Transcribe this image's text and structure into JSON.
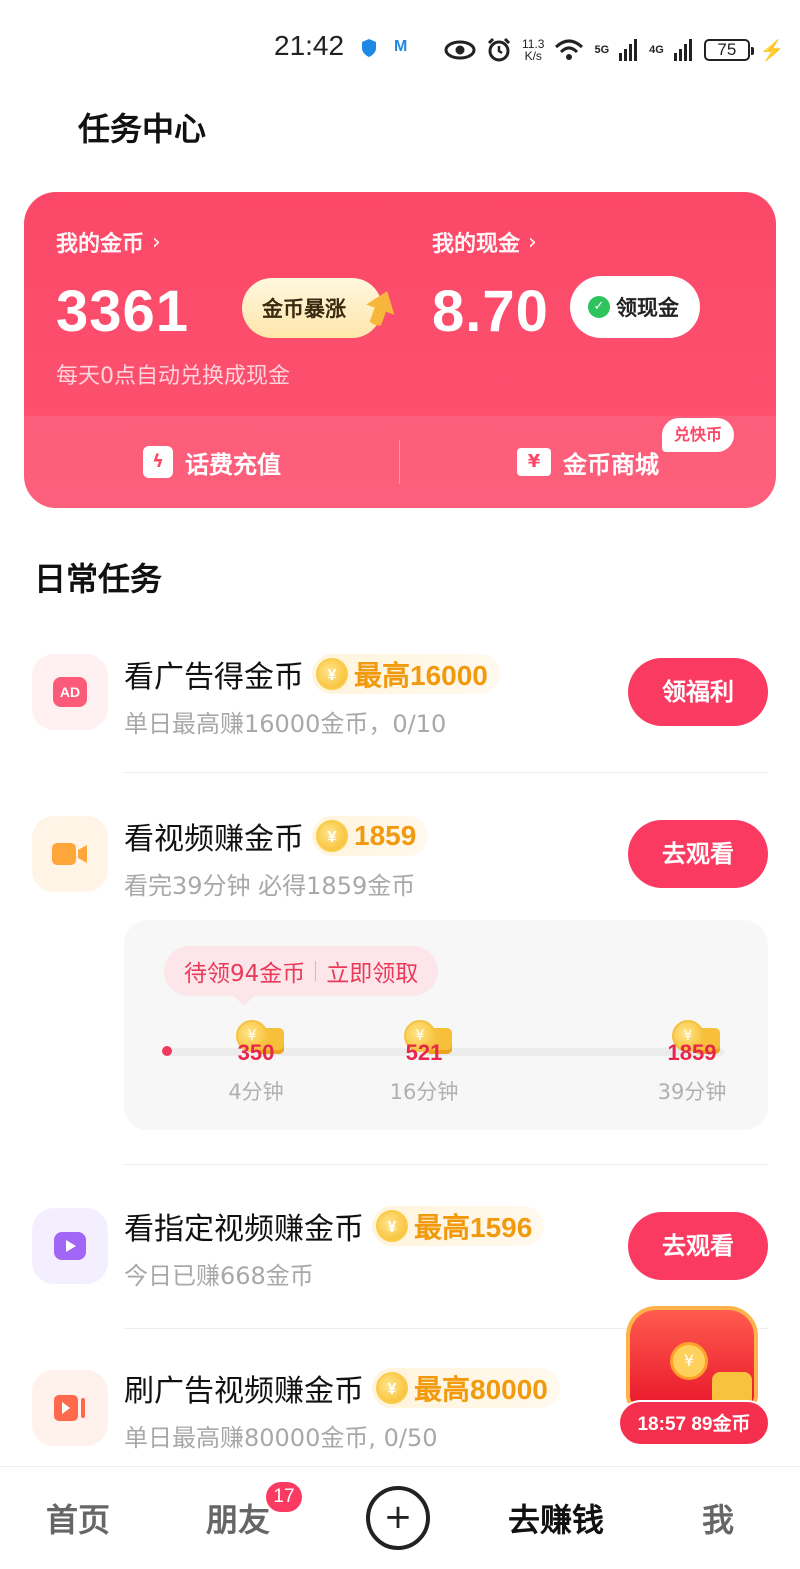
{
  "status_bar": {
    "time": "21:42",
    "speed_top": "11.3",
    "speed_bottom": "K/s",
    "net1": "5G",
    "net2": "4G",
    "battery": "75"
  },
  "header": {
    "title": "任务中心"
  },
  "wallet": {
    "coins_label": "我的金币",
    "coins_value": "3361",
    "coins_boost_label": "金币暴涨",
    "cash_label": "我的现金",
    "cash_value": "8.70",
    "cash_button_label": "领现金",
    "note": "每天0点自动兑换成现金",
    "recharge_label": "话费充值",
    "mall_label": "金币商城",
    "mall_badge": "兑快币"
  },
  "daily": {
    "title": "日常任务",
    "tasks": [
      {
        "title": "看广告得金币",
        "reward": "最高16000",
        "desc": "单日最高赚16000金币，0/10",
        "button": "领福利",
        "icon": "ad-icon",
        "icon_text": "AD",
        "icon_bg": "#fff0f2",
        "icon_fg": "#fb4868"
      },
      {
        "title": "看视频赚金币",
        "reward": "1859",
        "desc": "看完39分钟 必得1859金币",
        "button": "去观看",
        "icon": "video-camera-icon",
        "icon_bg": "#fff4e6",
        "icon_fg": "#ffa63a"
      },
      {
        "title": "看指定视频赚金币",
        "reward": "最高1596",
        "desc": "今日已赚668金币",
        "button": "去观看",
        "icon": "play-icon",
        "icon_bg": "#f4efff",
        "icon_fg": "#a166f5"
      },
      {
        "title": "刷广告视频赚金币",
        "reward": "最高80000",
        "desc": "单日最高赚80000金币, 0/50",
        "icon": "ad-video-icon",
        "icon_bg": "#fff1ec",
        "icon_fg": "#ff6a4d"
      }
    ]
  },
  "video_progress": {
    "pending_text": "待领94金币",
    "claim_text": "立即领取",
    "milestones": [
      {
        "value": "350",
        "time": "4分钟"
      },
      {
        "value": "521",
        "time": "16分钟"
      },
      {
        "value": "1859",
        "time": "39分钟"
      }
    ]
  },
  "chest": {
    "label": "18:57 89金币"
  },
  "nav": {
    "home": "首页",
    "friends": "朋友",
    "friends_badge": "17",
    "earn": "去赚钱",
    "me": "我"
  },
  "colors": {
    "accent": "#fb3a62",
    "card": "#fb4868",
    "reward": "#f29a0e"
  }
}
